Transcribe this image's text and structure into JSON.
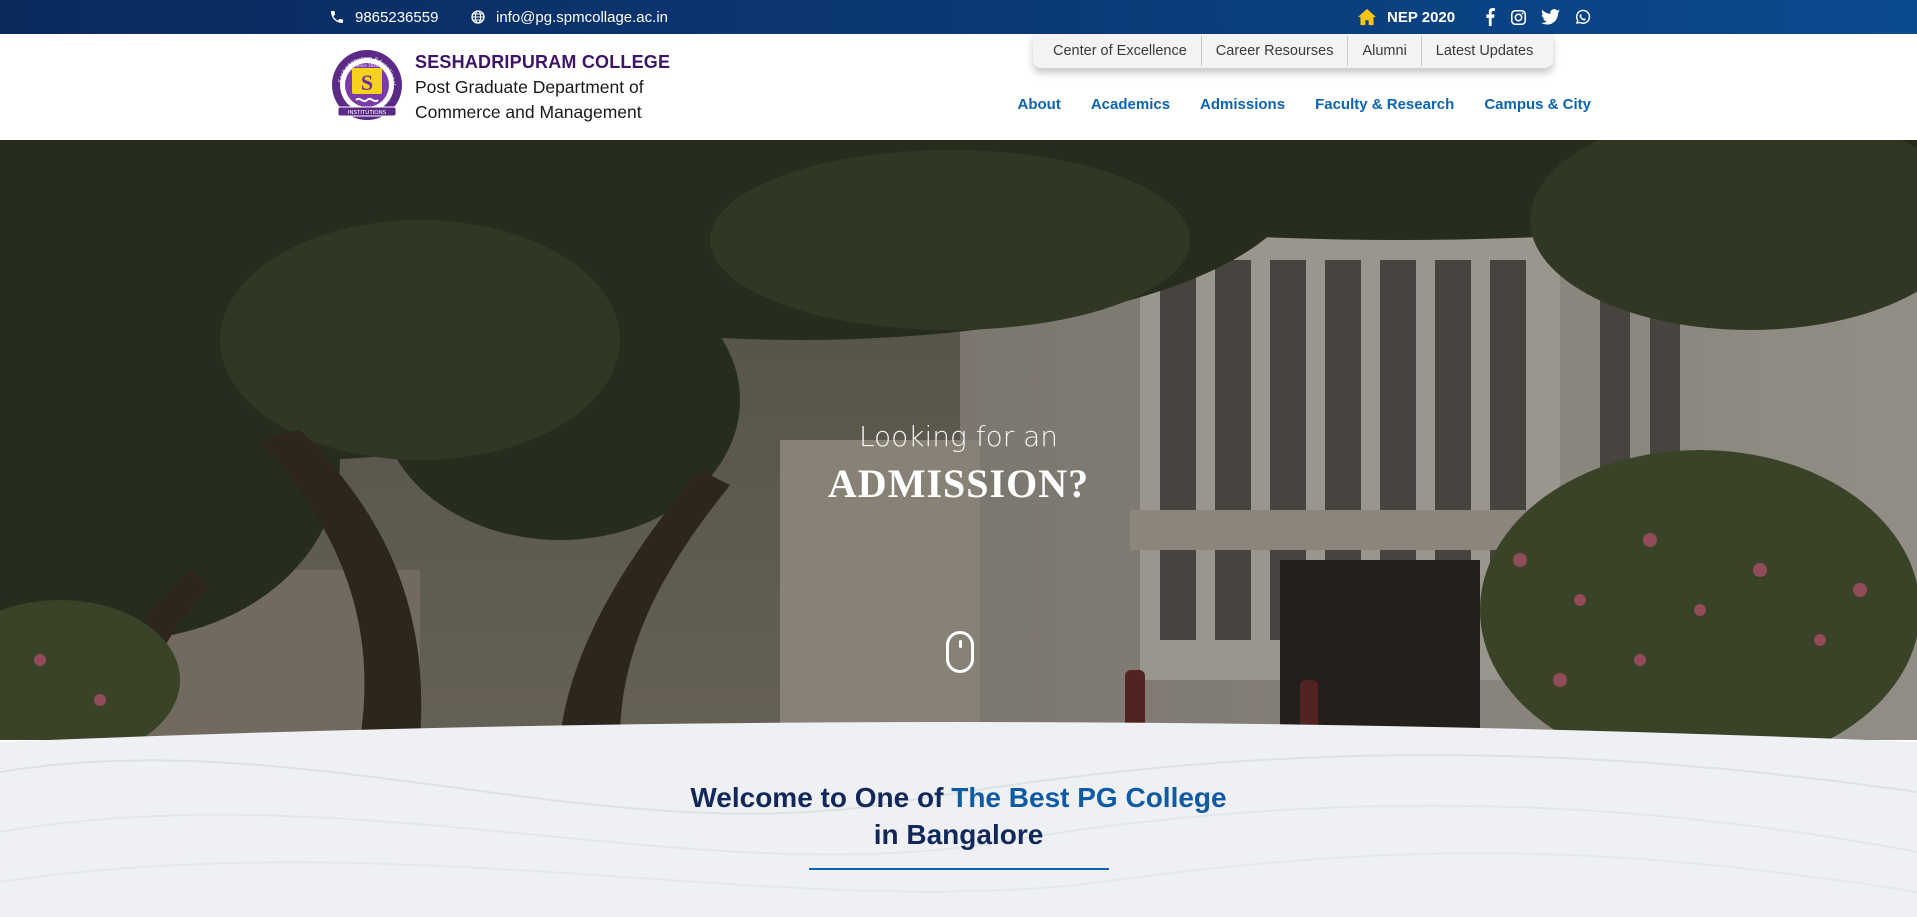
{
  "topbar": {
    "phone": "9865236559",
    "email": "info@pg.spmcollage.ac.in",
    "nep": "NEP 2020",
    "icons": [
      "phone-icon",
      "globe-icon",
      "home-icon",
      "facebook-icon",
      "instagram-icon",
      "twitter-icon",
      "whatsapp-icon"
    ],
    "background": "#0b3a78",
    "nep_icon_color": "#f5c518"
  },
  "brand": {
    "college": "SESHADRIPURAM COLLEGE",
    "dept_line1": "Post Graduate Department of",
    "dept_line2": "Commerce and Management",
    "logo_letter": "S",
    "logo_ring_text": "Seshadripuram Educational Trust",
    "logo_since": "Since 1930",
    "logo_banner": "INSTITUTIONS",
    "color": "#3d1466"
  },
  "utility_nav": [
    "Center of Excellence",
    "Career Resourses",
    "Alumni",
    "Latest Updates"
  ],
  "main_nav": [
    "About",
    "Academics",
    "Admissions",
    "Faculty & Research",
    "Campus & City"
  ],
  "hero": {
    "kicker": "Looking for an",
    "headline": "ADMISSION?"
  },
  "welcome": {
    "line1_prefix": "Welcome to One of",
    "line1_accent": "The Best PG College",
    "line2": "in Bangalore",
    "heading_color": "#13285a",
    "accent_color": "#0e5aa3"
  }
}
